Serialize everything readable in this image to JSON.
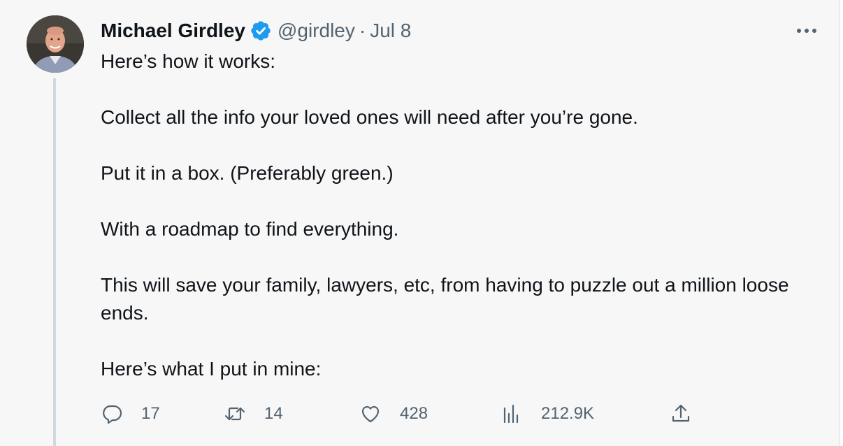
{
  "author": {
    "display_name": "Michael Girdley",
    "handle": "@girdley",
    "separator": "·",
    "date": "Jul 8",
    "verified": true,
    "verified_color": "#1d9bf0"
  },
  "tweet": {
    "paragraphs": [
      "Here’s how it works:",
      "Collect all the info your loved ones will need after you’re gone.",
      "Put it in a box. (Preferably green.)",
      "With a roadmap to find everything.",
      "This will save your family, lawyers, etc, from having to puzzle out a million loose ends.",
      "Here’s what I put in mine:"
    ]
  },
  "actions": {
    "replies": "17",
    "retweets": "14",
    "likes": "428",
    "views": "212.9K"
  },
  "icons": {
    "more": "more-horizontal-icon",
    "reply": "reply-bubble-icon",
    "retweet": "retweet-arrows-icon",
    "like": "heart-icon",
    "views": "bar-chart-icon",
    "share": "share-upload-icon"
  }
}
